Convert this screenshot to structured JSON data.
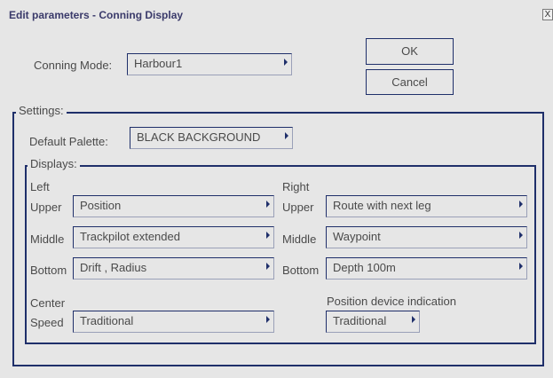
{
  "window": {
    "title": "Edit parameters - Conning Display",
    "close_glyph": "X"
  },
  "conning_mode": {
    "label": "Conning Mode:",
    "value": "Harbour1"
  },
  "buttons": {
    "ok": "OK",
    "cancel": "Cancel"
  },
  "settings": {
    "legend": "Settings:",
    "default_palette": {
      "label": "Default Palette:",
      "value": "BLACK BACKGROUND"
    }
  },
  "displays": {
    "legend": "Displays:",
    "left": {
      "heading": "Left",
      "upper": {
        "label": "Upper",
        "value": "Position"
      },
      "middle": {
        "label": "Middle",
        "value": "Trackpilot extended"
      },
      "bottom": {
        "label": "Bottom",
        "value": "Drift , Radius"
      }
    },
    "right": {
      "heading": "Right",
      "upper": {
        "label": "Upper",
        "value": "Route with next leg"
      },
      "middle": {
        "label": "Middle",
        "value": "Waypoint"
      },
      "bottom": {
        "label": "Bottom",
        "value": "Depth 100m"
      }
    },
    "center": {
      "heading": "Center",
      "speed": {
        "label": "Speed",
        "value": "Traditional"
      }
    },
    "position_device": {
      "label": "Position device indication",
      "value": "Traditional"
    }
  },
  "colors": {
    "border": "#1f2f6a",
    "background": "#e6e6e6",
    "text": "#4a4a4a"
  }
}
